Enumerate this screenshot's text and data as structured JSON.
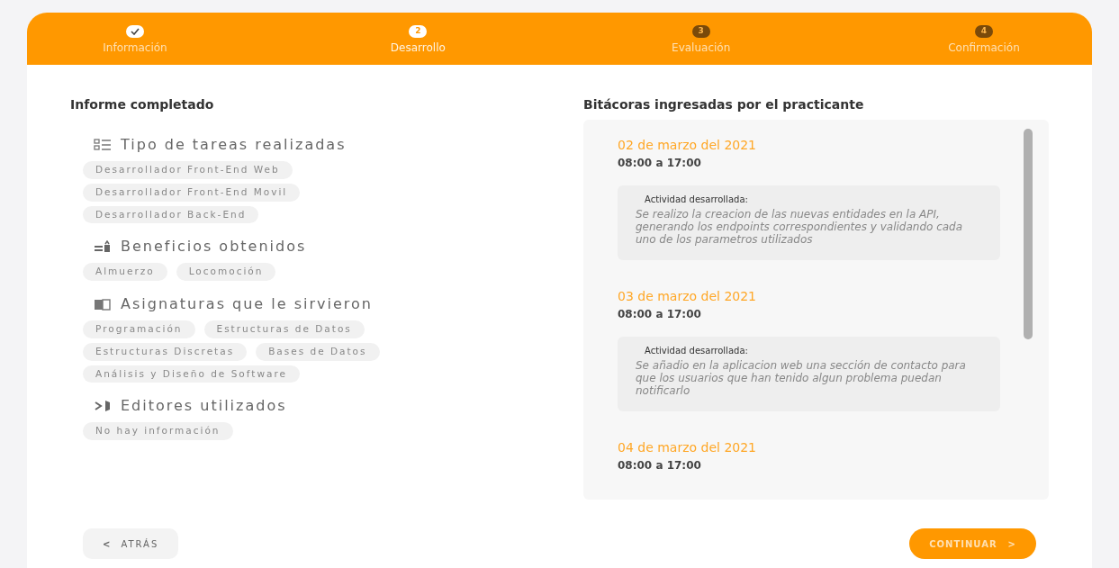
{
  "steps": [
    {
      "label": "Información",
      "completed": true,
      "selected": false
    },
    {
      "label": "Desarrollo",
      "marker": "2",
      "completed": false,
      "selected": true
    },
    {
      "label": "Evaluación",
      "marker": "3",
      "completed": false,
      "selected": false
    },
    {
      "label": "Confirmación",
      "marker": "4",
      "completed": false,
      "selected": false
    }
  ],
  "report": {
    "title": "Informe completado",
    "sections": [
      {
        "kind": "list",
        "title": "Tipo de tareas realizadas",
        "chips": [
          "Desarrollador Front-End Web",
          "Desarrollador Front-End Movil",
          "Desarrollador Back-End"
        ]
      },
      {
        "kind": "benefits",
        "title": "Beneficios obtenidos",
        "chips": [
          "Almuerzo",
          "Locomoción"
        ]
      },
      {
        "kind": "book",
        "title": "Asignaturas que le sirvieron",
        "chips": [
          "Programación",
          "Estructuras de Datos",
          "Estructuras Discretas",
          "Bases de Datos",
          "Análisis y Diseño de Software"
        ]
      },
      {
        "kind": "editor",
        "title": "Editores utilizados",
        "chips": [
          "No hay información"
        ]
      }
    ]
  },
  "logs": {
    "title": "Bitácoras ingresadas por el practicante",
    "entries": [
      {
        "date": "02 de marzo del 2021",
        "time": "08:00 a 17:00",
        "activity_label": "Actividad desarrollada:",
        "activity": "Se realizo la creacion de las nuevas entidades en la API, generando los endpoints correspondientes y validando cada uno de los parametros utilizados"
      },
      {
        "date": "03 de marzo del 2021",
        "time": "08:00 a 17:00",
        "activity_label": "Actividad desarrollada:",
        "activity": "Se añadio en la aplicacion web una sección de contacto para que los usuarios que han tenido algun problema puedan notificarlo"
      },
      {
        "date": "04 de marzo del 2021",
        "time": "08:00 a 17:00"
      }
    ]
  },
  "buttons": {
    "back": {
      "icon": "<",
      "label": "ATRÁS"
    },
    "next": {
      "label": "CONTINUAR",
      "icon": ">"
    }
  }
}
